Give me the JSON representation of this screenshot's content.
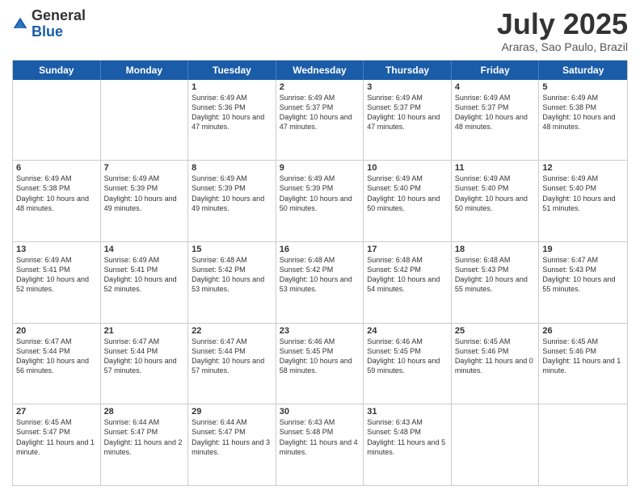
{
  "logo": {
    "general": "General",
    "blue": "Blue"
  },
  "title": "July 2025",
  "location": "Araras, Sao Paulo, Brazil",
  "header_days": [
    "Sunday",
    "Monday",
    "Tuesday",
    "Wednesday",
    "Thursday",
    "Friday",
    "Saturday"
  ],
  "weeks": [
    [
      {
        "day": "",
        "text": ""
      },
      {
        "day": "",
        "text": ""
      },
      {
        "day": "1",
        "text": "Sunrise: 6:49 AM\nSunset: 5:36 PM\nDaylight: 10 hours and 47 minutes."
      },
      {
        "day": "2",
        "text": "Sunrise: 6:49 AM\nSunset: 5:37 PM\nDaylight: 10 hours and 47 minutes."
      },
      {
        "day": "3",
        "text": "Sunrise: 6:49 AM\nSunset: 5:37 PM\nDaylight: 10 hours and 47 minutes."
      },
      {
        "day": "4",
        "text": "Sunrise: 6:49 AM\nSunset: 5:37 PM\nDaylight: 10 hours and 48 minutes."
      },
      {
        "day": "5",
        "text": "Sunrise: 6:49 AM\nSunset: 5:38 PM\nDaylight: 10 hours and 48 minutes."
      }
    ],
    [
      {
        "day": "6",
        "text": "Sunrise: 6:49 AM\nSunset: 5:38 PM\nDaylight: 10 hours and 48 minutes."
      },
      {
        "day": "7",
        "text": "Sunrise: 6:49 AM\nSunset: 5:39 PM\nDaylight: 10 hours and 49 minutes."
      },
      {
        "day": "8",
        "text": "Sunrise: 6:49 AM\nSunset: 5:39 PM\nDaylight: 10 hours and 49 minutes."
      },
      {
        "day": "9",
        "text": "Sunrise: 6:49 AM\nSunset: 5:39 PM\nDaylight: 10 hours and 50 minutes."
      },
      {
        "day": "10",
        "text": "Sunrise: 6:49 AM\nSunset: 5:40 PM\nDaylight: 10 hours and 50 minutes."
      },
      {
        "day": "11",
        "text": "Sunrise: 6:49 AM\nSunset: 5:40 PM\nDaylight: 10 hours and 50 minutes."
      },
      {
        "day": "12",
        "text": "Sunrise: 6:49 AM\nSunset: 5:40 PM\nDaylight: 10 hours and 51 minutes."
      }
    ],
    [
      {
        "day": "13",
        "text": "Sunrise: 6:49 AM\nSunset: 5:41 PM\nDaylight: 10 hours and 52 minutes."
      },
      {
        "day": "14",
        "text": "Sunrise: 6:49 AM\nSunset: 5:41 PM\nDaylight: 10 hours and 52 minutes."
      },
      {
        "day": "15",
        "text": "Sunrise: 6:48 AM\nSunset: 5:42 PM\nDaylight: 10 hours and 53 minutes."
      },
      {
        "day": "16",
        "text": "Sunrise: 6:48 AM\nSunset: 5:42 PM\nDaylight: 10 hours and 53 minutes."
      },
      {
        "day": "17",
        "text": "Sunrise: 6:48 AM\nSunset: 5:42 PM\nDaylight: 10 hours and 54 minutes."
      },
      {
        "day": "18",
        "text": "Sunrise: 6:48 AM\nSunset: 5:43 PM\nDaylight: 10 hours and 55 minutes."
      },
      {
        "day": "19",
        "text": "Sunrise: 6:47 AM\nSunset: 5:43 PM\nDaylight: 10 hours and 55 minutes."
      }
    ],
    [
      {
        "day": "20",
        "text": "Sunrise: 6:47 AM\nSunset: 5:44 PM\nDaylight: 10 hours and 56 minutes."
      },
      {
        "day": "21",
        "text": "Sunrise: 6:47 AM\nSunset: 5:44 PM\nDaylight: 10 hours and 57 minutes."
      },
      {
        "day": "22",
        "text": "Sunrise: 6:47 AM\nSunset: 5:44 PM\nDaylight: 10 hours and 57 minutes."
      },
      {
        "day": "23",
        "text": "Sunrise: 6:46 AM\nSunset: 5:45 PM\nDaylight: 10 hours and 58 minutes."
      },
      {
        "day": "24",
        "text": "Sunrise: 6:46 AM\nSunset: 5:45 PM\nDaylight: 10 hours and 59 minutes."
      },
      {
        "day": "25",
        "text": "Sunrise: 6:45 AM\nSunset: 5:46 PM\nDaylight: 11 hours and 0 minutes."
      },
      {
        "day": "26",
        "text": "Sunrise: 6:45 AM\nSunset: 5:46 PM\nDaylight: 11 hours and 1 minute."
      }
    ],
    [
      {
        "day": "27",
        "text": "Sunrise: 6:45 AM\nSunset: 5:47 PM\nDaylight: 11 hours and 1 minute."
      },
      {
        "day": "28",
        "text": "Sunrise: 6:44 AM\nSunset: 5:47 PM\nDaylight: 11 hours and 2 minutes."
      },
      {
        "day": "29",
        "text": "Sunrise: 6:44 AM\nSunset: 5:47 PM\nDaylight: 11 hours and 3 minutes."
      },
      {
        "day": "30",
        "text": "Sunrise: 6:43 AM\nSunset: 5:48 PM\nDaylight: 11 hours and 4 minutes."
      },
      {
        "day": "31",
        "text": "Sunrise: 6:43 AM\nSunset: 5:48 PM\nDaylight: 11 hours and 5 minutes."
      },
      {
        "day": "",
        "text": ""
      },
      {
        "day": "",
        "text": ""
      }
    ]
  ]
}
